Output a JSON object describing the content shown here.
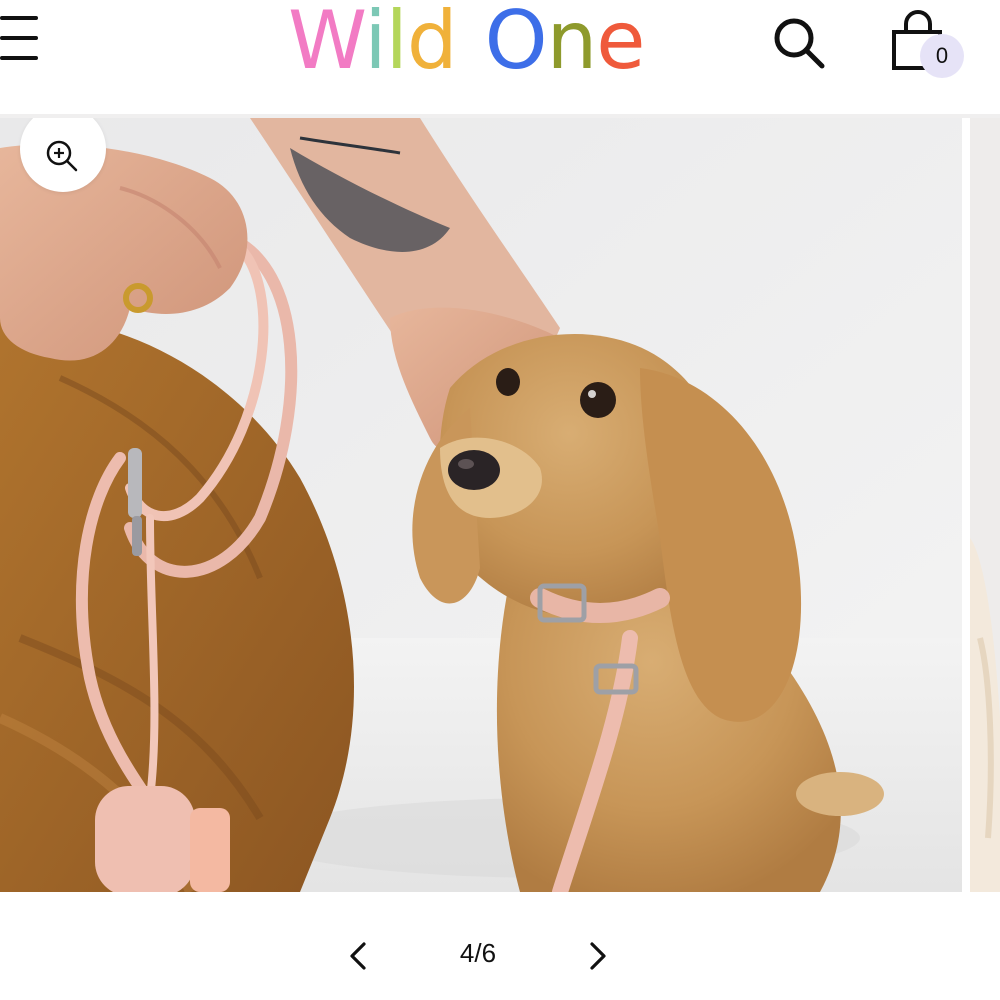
{
  "header": {
    "logo": {
      "word1": [
        {
          "char": "W",
          "color": "#f27bc4"
        },
        {
          "char": "i",
          "color": "#7cc8b5"
        },
        {
          "char": "l",
          "color": "#b4d65a"
        },
        {
          "char": "d",
          "color": "#f0b13a"
        }
      ],
      "word2": [
        {
          "char": "O",
          "color": "#3d6ee8"
        },
        {
          "char": "n",
          "color": "#8e9a2c"
        },
        {
          "char": "e",
          "color": "#ef5a3b"
        }
      ]
    },
    "menu_icon": "hamburger-menu-icon",
    "search_icon": "search-icon",
    "cart_icon": "shopping-bag-icon",
    "cart_count": "0"
  },
  "gallery": {
    "zoom_icon": "zoom-in-icon",
    "image_subject": "dog-with-pink-leash-photo"
  },
  "pager": {
    "prev_icon": "chevron-left-icon",
    "next_icon": "chevron-right-icon",
    "current": "4",
    "total": "6",
    "counter": "4/6"
  }
}
